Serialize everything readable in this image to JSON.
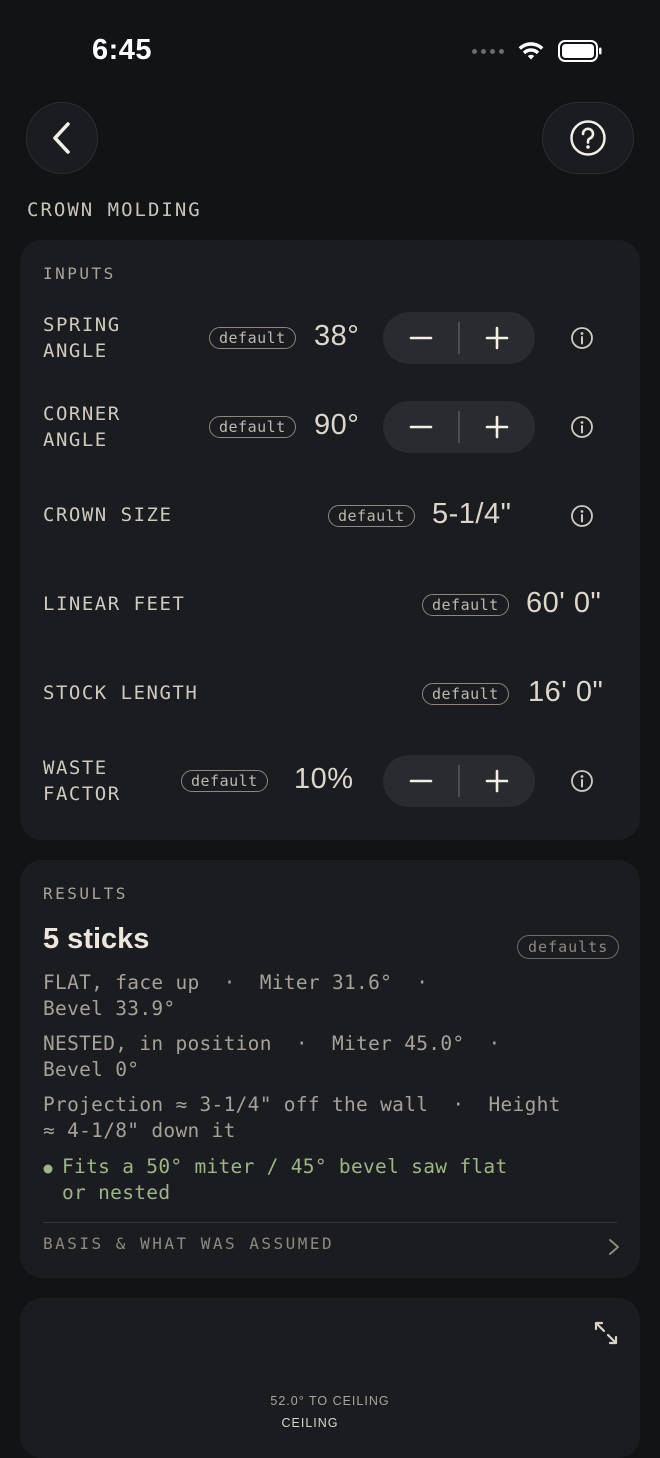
{
  "status": {
    "time": "6:45"
  },
  "header": {
    "title": "CROWN MOLDING"
  },
  "inputs": {
    "section_label": "INPUTS",
    "rows": [
      {
        "label_line1": "SPRING",
        "label_line2": "ANGLE",
        "badge": "default",
        "value": "38°"
      },
      {
        "label_line1": "CORNER",
        "label_line2": "ANGLE",
        "badge": "default",
        "value": "90°"
      },
      {
        "label": "CROWN SIZE",
        "badge": "default",
        "value": "5-1/4\""
      },
      {
        "label": "LINEAR FEET",
        "badge": "default",
        "value": "60' 0\""
      },
      {
        "label": "STOCK LENGTH",
        "badge": "default",
        "value": "16' 0\""
      },
      {
        "label_line1": "WASTE",
        "label_line2": "FACTOR",
        "badge": "default",
        "value": "10%"
      }
    ]
  },
  "results": {
    "section_label": "RESULTS",
    "headline": "5 sticks",
    "badge": "defaults",
    "flat_line1": "FLAT, face up  ·  Miter 31.6°  ·",
    "flat_line2": "Bevel 33.9°",
    "nested_line1": "NESTED, in position  ·  Miter 45.0°  ·",
    "nested_line2": "Bevel 0°",
    "projection_line1": "Projection ≈ 3-1/4\" off the wall  ·  Height",
    "projection_line2": "≈ 4-1/8\" down it",
    "fits_line1": "Fits a 50° miter / 45° bevel saw flat",
    "fits_line2": "or nested",
    "basis_label": "BASIS & WHAT WAS ASSUMED"
  },
  "diagram": {
    "angle_note": "52.0° TO CEILING",
    "ceiling_label": "CEILING"
  },
  "colors": {
    "accent_green": "#9fb48a",
    "background": "#121315",
    "card": "#1b1c1f"
  }
}
